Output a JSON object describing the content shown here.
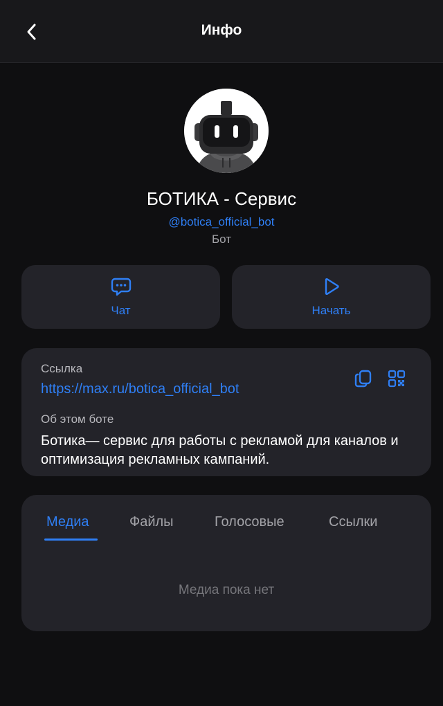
{
  "header": {
    "title": "Инфо",
    "back_icon": "chevron-left-icon"
  },
  "profile": {
    "name": "БОТИКА - Сервис",
    "username": "@botica_official_bot",
    "type": "Бот",
    "avatar": "robot-avatar"
  },
  "actions": [
    {
      "label": "Чат",
      "icon": "chat-bubble-icon"
    },
    {
      "label": "Начать",
      "icon": "play-icon"
    }
  ],
  "info": {
    "link_caption": "Ссылка",
    "link": "https://max.ru/botica_official_bot",
    "about_caption": "Об этом боте",
    "about": "Ботика— сервис для работы с рекламой для каналов и оптимизация рекламных кампаний.",
    "copy_icon": "copy-icon",
    "qr_icon": "qr-code-icon"
  },
  "media": {
    "tabs": [
      "Медиа",
      "Файлы",
      "Голосовые",
      "Ссылки"
    ],
    "active_tab": "Медиа",
    "empty_text": "Медиа пока нет"
  },
  "colors": {
    "background": "#0f0f11",
    "header": "#18181b",
    "card": "#232329",
    "accent": "#2f7ff5",
    "muted": "#a3a3a8"
  }
}
